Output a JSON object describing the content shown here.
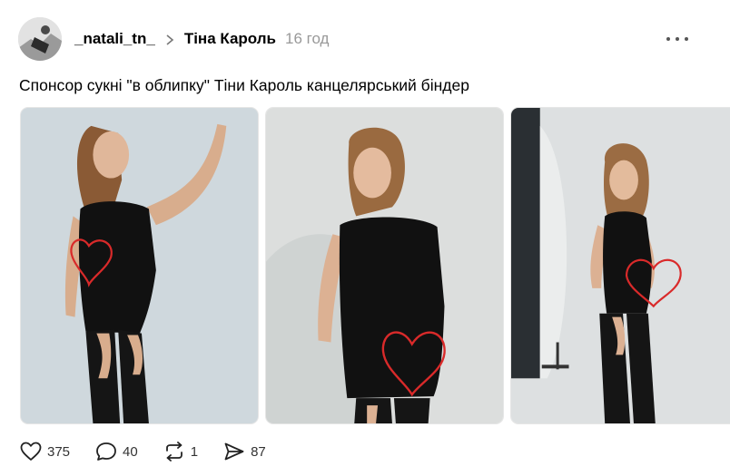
{
  "post": {
    "username": "_natali_tn_",
    "topic": "Тіна Кароль",
    "time": "16 год",
    "caption": "Спонсор сукні \"в облипку\" Тіни Кароль канцелярський біндер"
  },
  "actions": {
    "likes": "375",
    "comments": "40",
    "reposts": "1",
    "shares": "87"
  },
  "media": {
    "photos": [
      {
        "label": "photo-1"
      },
      {
        "label": "photo-2"
      },
      {
        "label": "photo-3"
      }
    ]
  },
  "colors": {
    "heart_annotation": "#d92a2a",
    "dress": "#111111",
    "background_wall": "#cfd3d6",
    "muted_text": "#999999"
  },
  "icons": [
    "heart-icon",
    "comment-icon",
    "repost-icon",
    "share-icon",
    "more-icon",
    "chevron-right-icon"
  ]
}
